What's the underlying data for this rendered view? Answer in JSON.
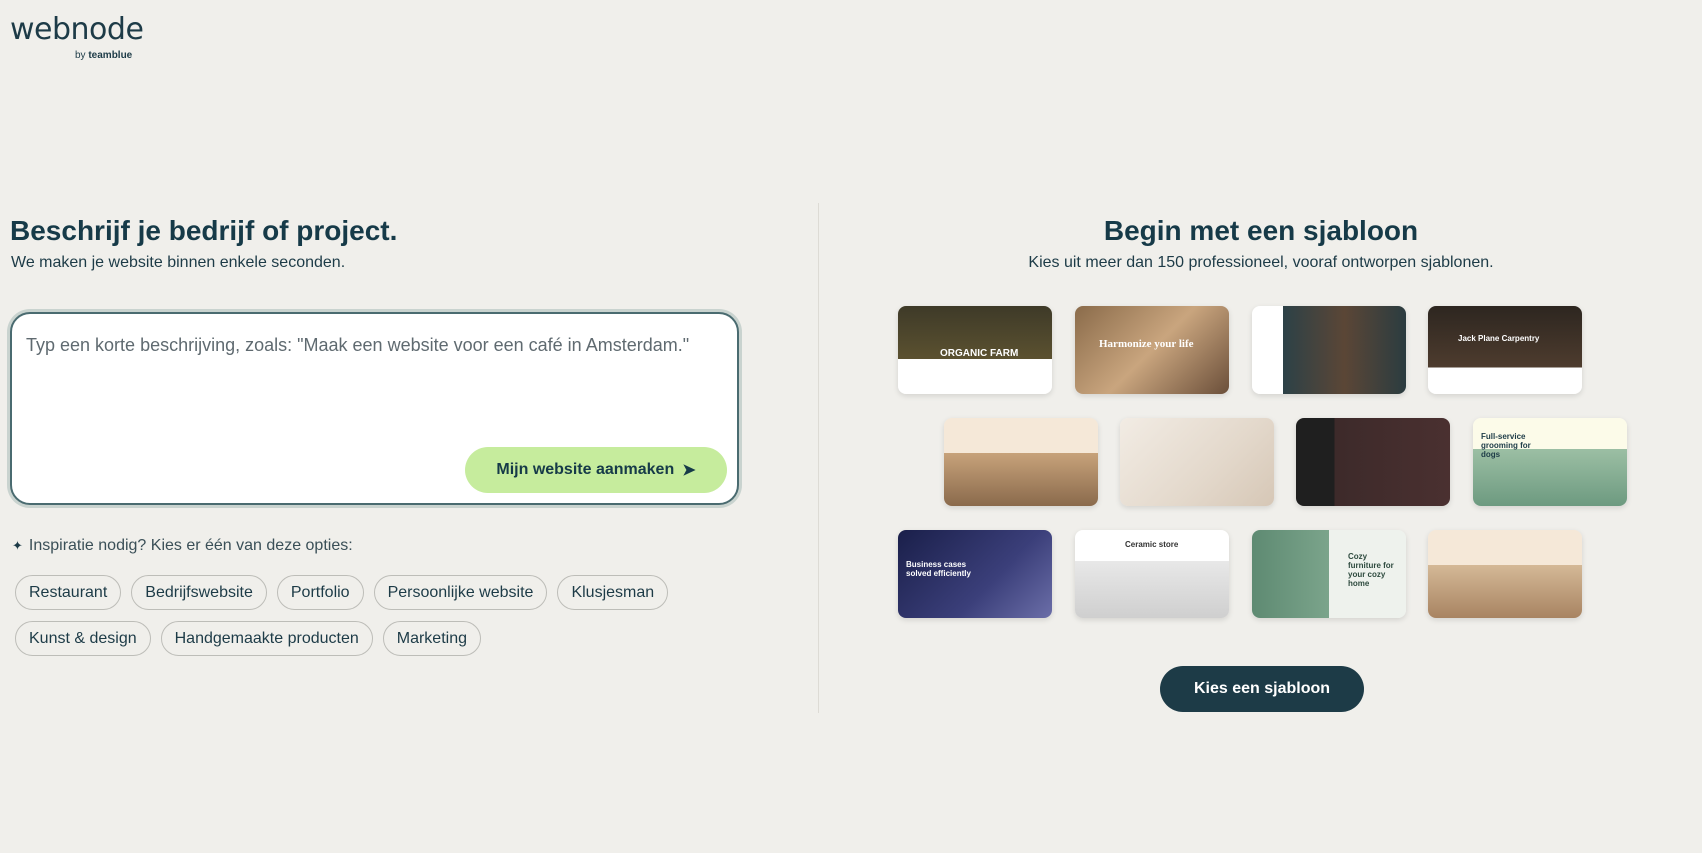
{
  "logo": {
    "name": "webnode",
    "by": "by",
    "brand": "teamblue"
  },
  "left": {
    "title": "Beschrijf je bedrijf of project.",
    "subtitle": "We maken je website binnen enkele seconden.",
    "input_placeholder": "Typ een korte beschrijving, zoals: \"Maak een website voor een café in Amsterdam.\"",
    "create_button": "Mijn website aanmaken",
    "inspiration": "Inspiratie nodig? Kies er één van deze opties:",
    "chips": [
      "Restaurant",
      "Bedrijfswebsite",
      "Portfolio",
      "Persoonlijke website",
      "Klusjesman",
      "Kunst & design",
      "Handgemaakte producten",
      "Marketing"
    ]
  },
  "right": {
    "title": "Begin met een sjabloon",
    "subtitle": "Kies uit meer dan 150 professioneel, vooraf ontworpen sjablonen.",
    "choose_button": "Kies een sjabloon",
    "templates": [
      {
        "label": "ORGANIC FARM"
      },
      {
        "label": "Harmonize your life"
      },
      {
        "label": ""
      },
      {
        "label": "Jack Plane Carpentry"
      },
      {
        "label": ""
      },
      {
        "label": ""
      },
      {
        "label": ""
      },
      {
        "label": "Full-service grooming for dogs"
      },
      {
        "label": "Business cases solved efficiently"
      },
      {
        "label": "Ceramic store"
      },
      {
        "label": "Cozy furniture for your cozy home"
      },
      {
        "label": ""
      }
    ]
  },
  "colors": {
    "background": "#f0efeb",
    "primary": "#1d3b47",
    "accent": "#c6ec9d"
  }
}
